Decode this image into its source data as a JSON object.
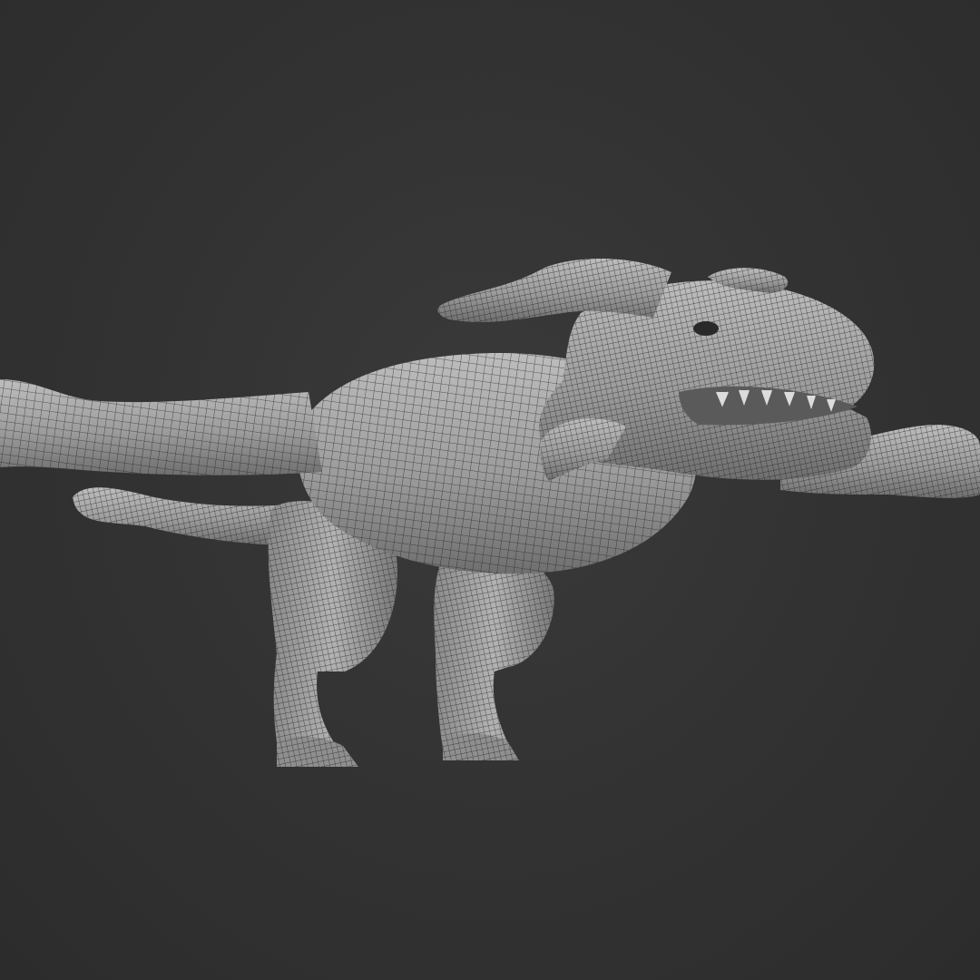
{
  "viewport": {
    "background_color": "#303030",
    "mesh_fill_color": "#9a9a9a",
    "mesh_wire_color": "#1e1e1e",
    "subject": "dinosaur-wireframe-mesh"
  }
}
